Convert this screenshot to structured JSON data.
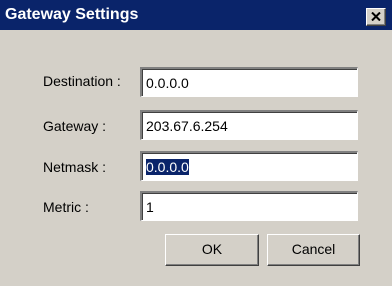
{
  "window": {
    "title": "Gateway Settings",
    "close_icon": "close-icon"
  },
  "form": {
    "destination": {
      "label": "Destination :",
      "value": "0.0.0.0"
    },
    "gateway": {
      "label": "Gateway :",
      "value": "203.67.6.254"
    },
    "netmask": {
      "label": "Netmask :",
      "value": "0.0.0.0",
      "selected": true
    },
    "metric": {
      "label": "Metric :",
      "value": "1"
    }
  },
  "buttons": {
    "ok_label": "OK",
    "cancel_label": "Cancel"
  },
  "colors": {
    "titlebar": "#0a246a",
    "dialog_face": "#d4d0c8",
    "selection": "#0a246a"
  }
}
